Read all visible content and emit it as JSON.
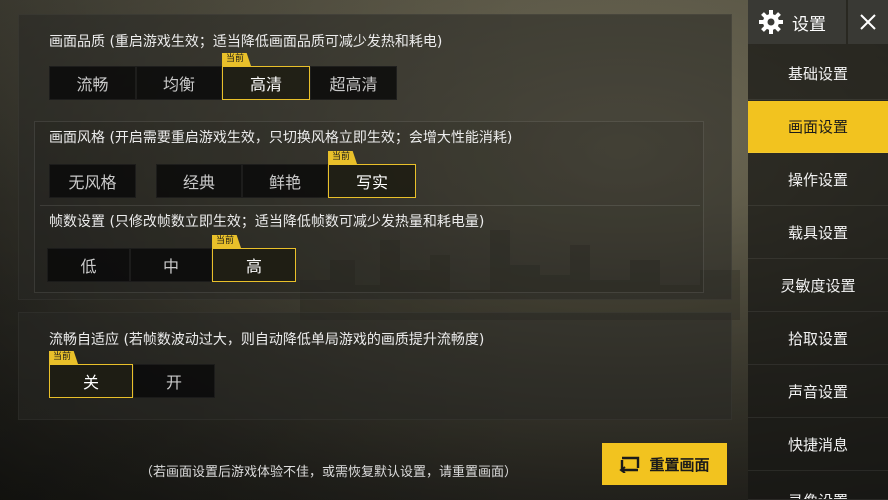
{
  "settings": {
    "title": "设置",
    "sidebar_items": [
      {
        "label": "基础设置"
      },
      {
        "label": "画面设置"
      },
      {
        "label": "操作设置"
      },
      {
        "label": "载具设置"
      },
      {
        "label": "灵敏度设置"
      },
      {
        "label": "拾取设置"
      },
      {
        "label": "声音设置"
      },
      {
        "label": "快捷消息"
      },
      {
        "label": "录像设置"
      }
    ],
    "active_item": "画面设置"
  },
  "graphics": {
    "current_badge": "当前",
    "quality": {
      "title": "画面品质 (重启游戏生效；适当降低画面品质可减少发热和耗电)",
      "options": [
        "流畅",
        "均衡",
        "高清",
        "超高清"
      ],
      "selected": "高清"
    },
    "style": {
      "title": "画面风格 (开启需要重启游戏生效，只切换风格立即生效；会增大性能消耗)",
      "options": [
        "无风格",
        "经典",
        "鲜艳",
        "写实"
      ],
      "selected": "写实"
    },
    "framerate": {
      "title": "帧数设置 (只修改帧数立即生效；适当降低帧数可减少发热量和耗电量)",
      "options": [
        "低",
        "中",
        "高"
      ],
      "selected": "高"
    },
    "adaptive": {
      "title": "流畅自适应 (若帧数波动过大，则自动降低单局游戏的画质提升流畅度)",
      "options": [
        "关",
        "开"
      ],
      "selected": "关"
    },
    "footnote": "（若画面设置后游戏体验不佳，或需恢复默认设置，请重置画面）",
    "reset_label": "重置画面"
  },
  "colors": {
    "accent": "#f2c31f",
    "selected_border": "#e9c02a"
  }
}
